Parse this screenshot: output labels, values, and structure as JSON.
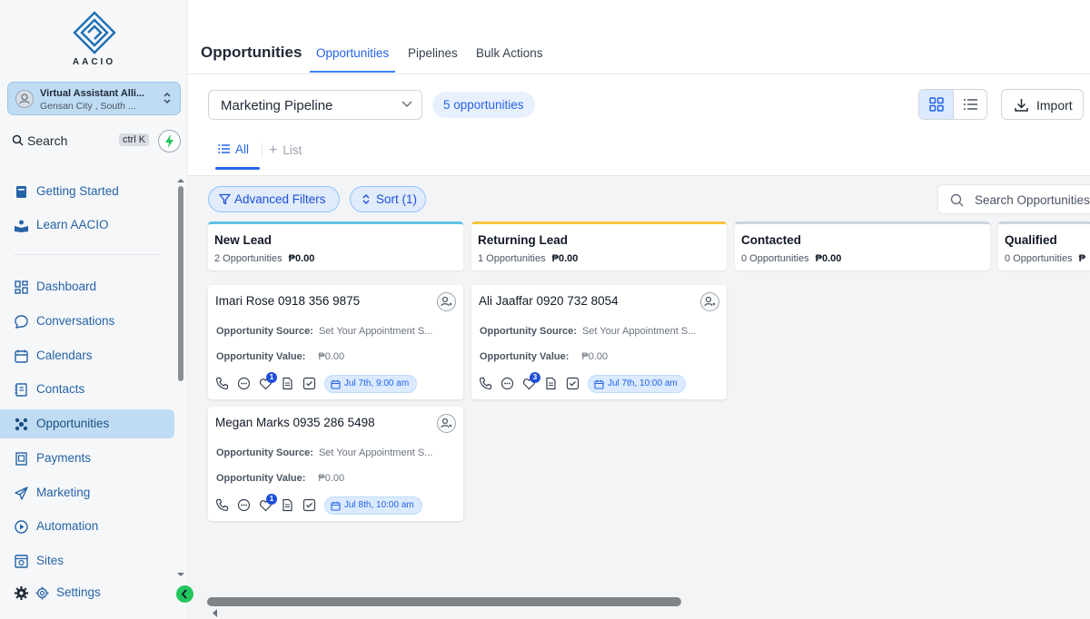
{
  "brand": {
    "name": "AACIO"
  },
  "account": {
    "name": "Virtual Assistant Alli...",
    "location": "Gensan City , South ..."
  },
  "sidebar_search": {
    "label": "Search",
    "shortcut": "ctrl K"
  },
  "sidebar": {
    "items": [
      {
        "label": "Getting Started",
        "icon": "book-icon"
      },
      {
        "label": "Learn AACIO",
        "icon": "learn-icon"
      },
      {
        "label": "Dashboard",
        "icon": "dashboard-icon"
      },
      {
        "label": "Conversations",
        "icon": "chat-icon"
      },
      {
        "label": "Calendars",
        "icon": "calendar-icon"
      },
      {
        "label": "Contacts",
        "icon": "contacts-icon"
      },
      {
        "label": "Opportunities",
        "icon": "opportunities-icon",
        "active": true
      },
      {
        "label": "Payments",
        "icon": "payments-icon"
      },
      {
        "label": "Marketing",
        "icon": "send-icon"
      },
      {
        "label": "Automation",
        "icon": "automation-icon"
      },
      {
        "label": "Sites",
        "icon": "sites-icon"
      }
    ],
    "settings_label": "Settings"
  },
  "header": {
    "title": "Opportunities",
    "tabs": [
      {
        "label": "Opportunities",
        "active": true
      },
      {
        "label": "Pipelines"
      },
      {
        "label": "Bulk Actions"
      }
    ]
  },
  "toolbar": {
    "pipeline": "Marketing Pipeline",
    "count": "5 opportunities",
    "import_label": "Import",
    "subtabs": [
      {
        "label": "All",
        "active": true
      },
      {
        "label": "List"
      }
    ]
  },
  "filters": {
    "advanced": "Advanced Filters",
    "sort": "Sort (1)",
    "search_placeholder": "Search Opportunities"
  },
  "stages": [
    {
      "name": "New Lead",
      "count": "2 Opportunities",
      "amount": "₱0.00",
      "color": "#60c3e6"
    },
    {
      "name": "Returning Lead",
      "count": "1 Opportunities",
      "amount": "₱0.00",
      "color": "#f5c542"
    },
    {
      "name": "Contacted",
      "count": "0 Opportunities",
      "amount": "₱0.00",
      "color": "#cbd5e1"
    },
    {
      "name": "Qualified",
      "count": "0 Opportunities",
      "amount": "₱",
      "color": "#cbd5e1"
    }
  ],
  "cards": [
    {
      "title": "Imari Rose 0918 356 9875",
      "source_label": "Opportunity Source:",
      "source": "Set Your Appointment S...",
      "value_label": "Opportunity Value:",
      "value": "₱0.00",
      "badge": "1",
      "date": "Jul 7th, 9:00 am"
    },
    {
      "title": "Ali Jaaffar 0920 732 8054",
      "source_label": "Opportunity Source:",
      "source": "Set Your Appointment S...",
      "value_label": "Opportunity Value:",
      "value": "₱0.00",
      "badge": "3",
      "date": "Jul 7th, 10:00 am"
    },
    {
      "title": "Megan Marks 0935 286 5498",
      "source_label": "Opportunity Source:",
      "source": "Set Your Appointment S...",
      "value_label": "Opportunity Value:",
      "value": "₱0.00",
      "badge": "1",
      "date": "Jul 8th, 10:00 am"
    }
  ],
  "colors": {
    "accent": "#2563eb",
    "active_bg": "#bfdcf3",
    "green": "#22c55e"
  }
}
